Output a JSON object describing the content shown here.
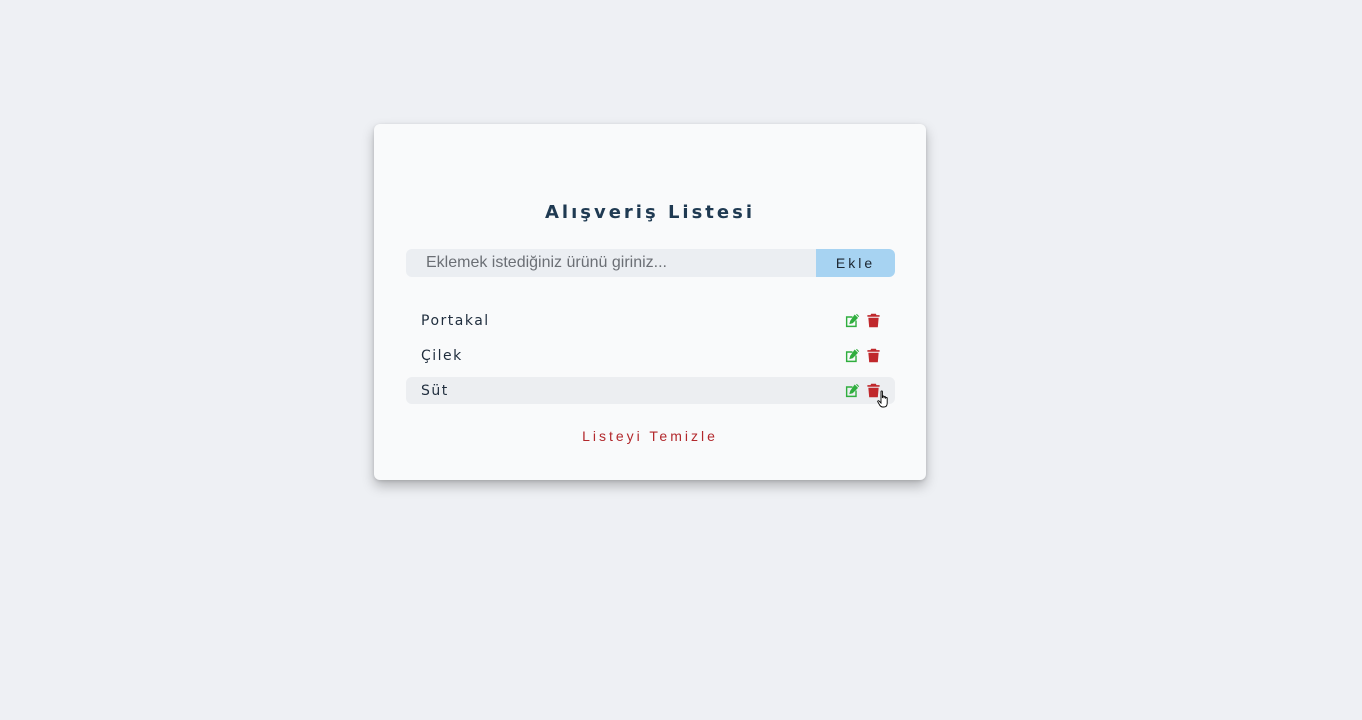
{
  "app": {
    "title": "Alışveriş Listesi"
  },
  "form": {
    "placeholder": "Eklemek istediğiniz ürünü giriniz...",
    "value": "",
    "add_label": "Ekle"
  },
  "items": [
    {
      "label": "Portakal",
      "edit_icon": "edit-icon",
      "delete_icon": "trash-icon"
    },
    {
      "label": "Çilek",
      "edit_icon": "edit-icon",
      "delete_icon": "trash-icon"
    },
    {
      "label": "Süt",
      "edit_icon": "edit-icon",
      "delete_icon": "trash-icon",
      "hovered": true
    }
  ],
  "clear_label": "Listeyi Temizle",
  "colors": {
    "background": "#eef0f4",
    "card": "#f9fafb",
    "title": "#1f3a52",
    "add_button": "#a7d3f2",
    "edit_icon": "#2fae3e",
    "delete_icon": "#c0282c",
    "clear_text": "#b2282c"
  }
}
